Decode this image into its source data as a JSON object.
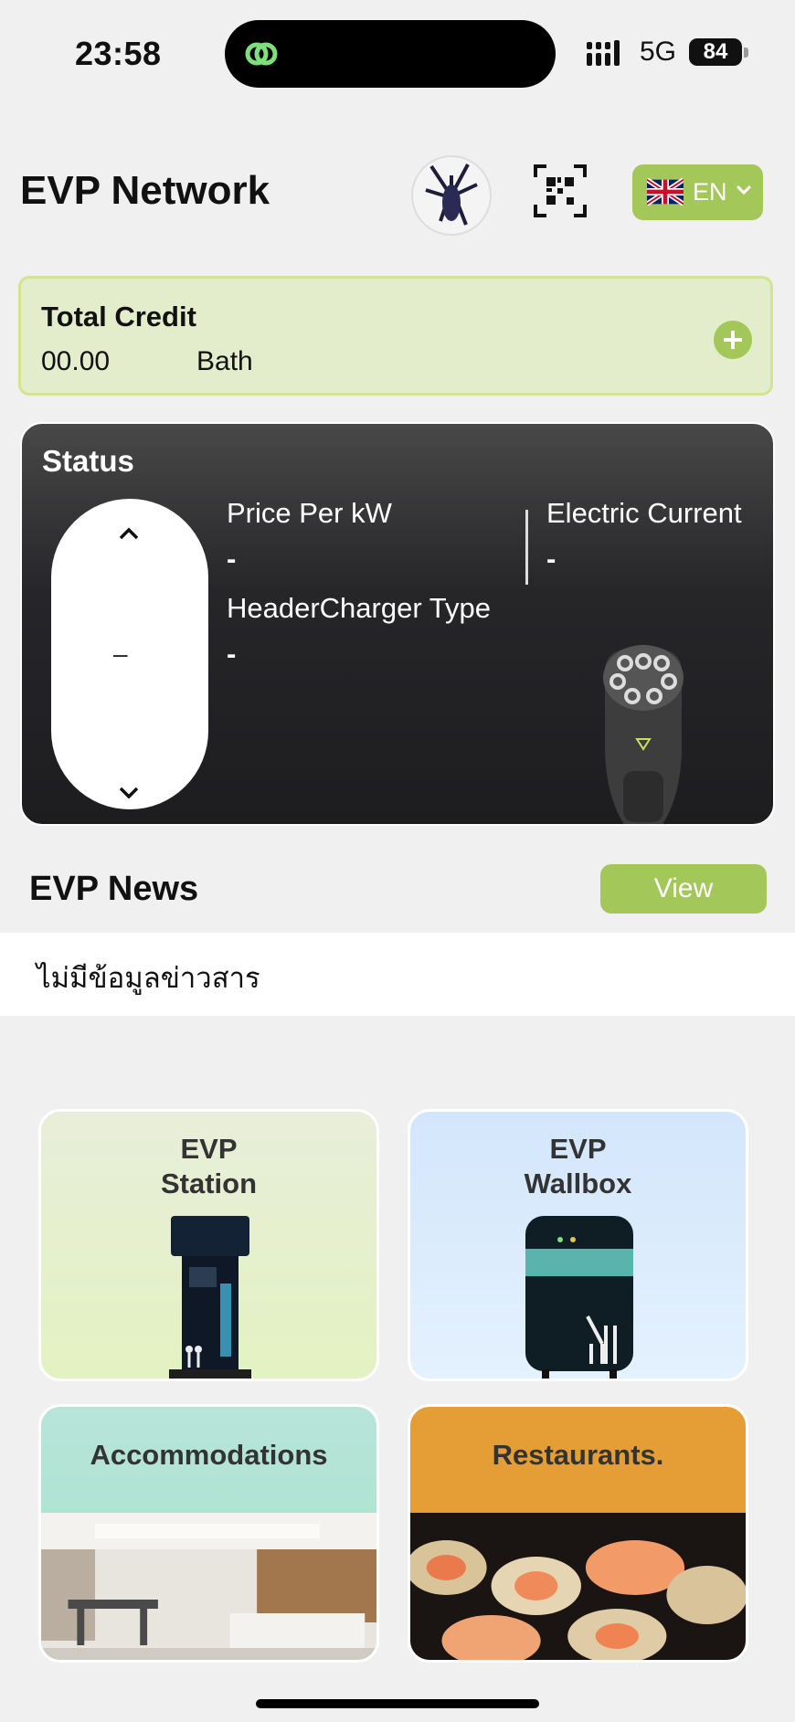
{
  "status_bar": {
    "time": "23:58",
    "network": "5G",
    "battery": "84"
  },
  "header": {
    "title": "EVP Network",
    "language": "EN",
    "avatar_icon": "user-avatar",
    "qr_icon": "qr-code-icon"
  },
  "credit": {
    "title": "Total Credit",
    "amount": "00.00",
    "unit": "Bath"
  },
  "status": {
    "title": "Status",
    "picker_value": "–",
    "price_label": "Price Per kW",
    "price_value": "-",
    "current_label": "Electric Current",
    "current_value": "-",
    "charger_type_label": "HeaderCharger Type",
    "charger_type_value": "-"
  },
  "news": {
    "title": "EVP News",
    "view_label": "View",
    "empty_text": "ไม่มีข้อมูลข่าวสาร"
  },
  "tiles": [
    {
      "line1": "EVP",
      "line2": "Station"
    },
    {
      "line1": "EVP",
      "line2": "Wallbox"
    },
    {
      "line1": "Accommodations"
    },
    {
      "line1": "Restaurants."
    }
  ],
  "colors": {
    "accent": "#a4c75a",
    "credit_bg": "#e3eccb",
    "status_bg": "#1d1d20",
    "restaurant_tile": "#e49e35",
    "accommodation_tile": "#a5e5c8"
  }
}
